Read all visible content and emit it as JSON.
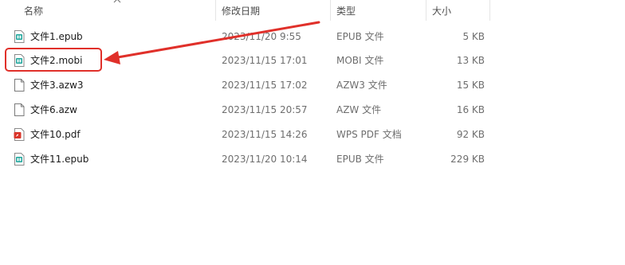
{
  "columns": {
    "name": "名称",
    "date": "修改日期",
    "type": "类型",
    "size": "大小"
  },
  "files": [
    {
      "name": "文件1.epub",
      "date": "2023/11/20 9:55",
      "type": "EPUB 文件",
      "size": "5 KB",
      "icon": "ebook-icon"
    },
    {
      "name": "文件2.mobi",
      "date": "2023/11/15 17:01",
      "type": "MOBI 文件",
      "size": "13 KB",
      "icon": "ebook-icon"
    },
    {
      "name": "文件3.azw3",
      "date": "2023/11/15 17:02",
      "type": "AZW3 文件",
      "size": "15 KB",
      "icon": "blank-file-icon"
    },
    {
      "name": "文件6.azw",
      "date": "2023/11/15 20:57",
      "type": "AZW 文件",
      "size": "16 KB",
      "icon": "blank-file-icon"
    },
    {
      "name": "文件10.pdf",
      "date": "2023/11/15 14:26",
      "type": "WPS PDF 文档",
      "size": "92 KB",
      "icon": "pdf-icon"
    },
    {
      "name": "文件11.epub",
      "date": "2023/11/20 10:14",
      "type": "EPUB 文件",
      "size": "229 KB",
      "icon": "ebook-icon"
    }
  ],
  "colors": {
    "accent_red": "#e0302a",
    "ebook_teal": "#1ea59b",
    "pdf_red": "#d9362b"
  }
}
